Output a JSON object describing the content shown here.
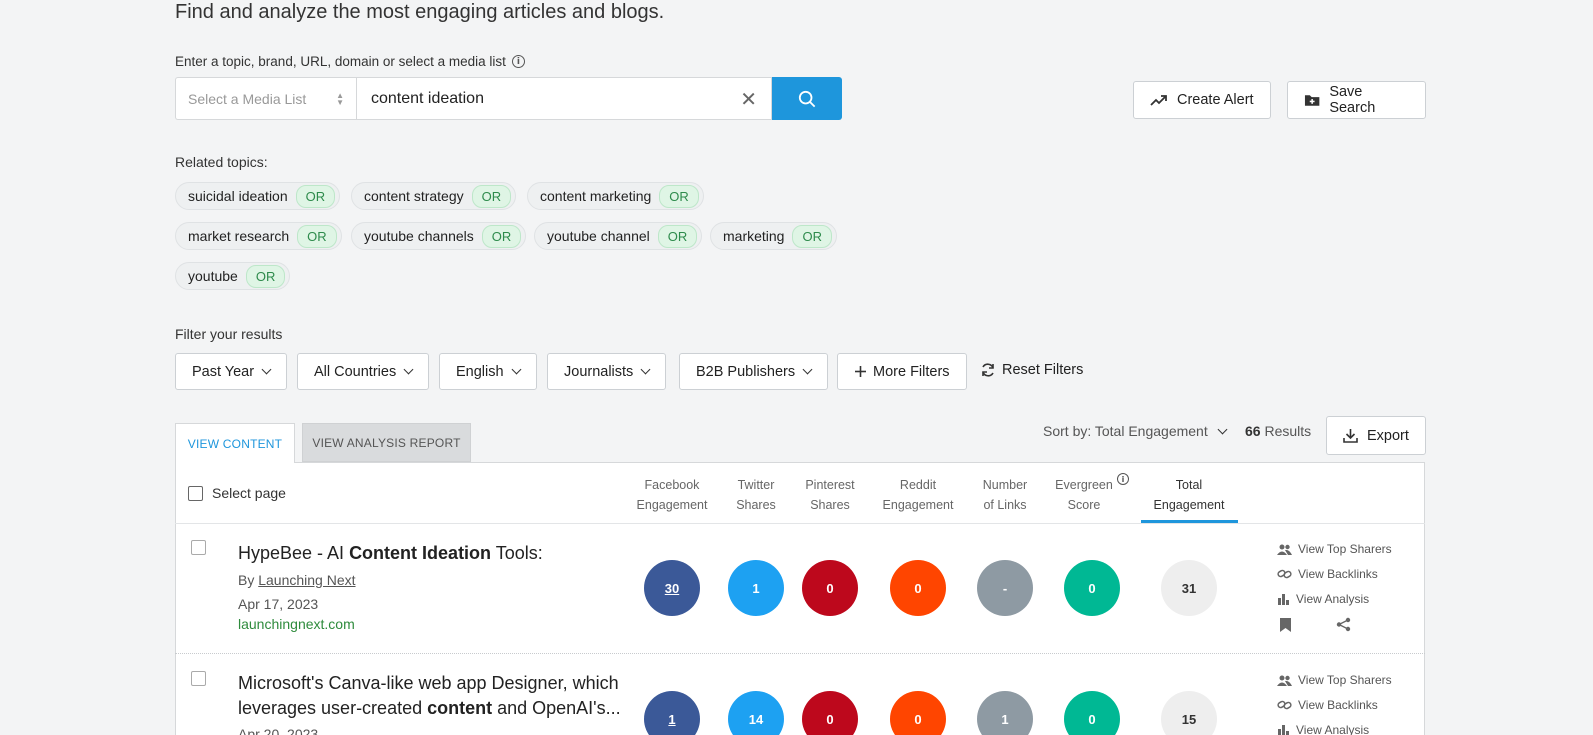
{
  "header": {
    "subtitle": "Find and analyze the most engaging articles and blogs."
  },
  "search": {
    "label": "Enter a topic, brand, URL, domain or select a media list",
    "media_list_placeholder": "Select a Media List",
    "query": "content ideation"
  },
  "actions": {
    "create_alert": "Create Alert",
    "save_search": "Save Search"
  },
  "related": {
    "label": "Related topics:",
    "or_label": "OR",
    "topics": [
      "suicidal ideation",
      "content strategy",
      "content marketing",
      "market research",
      "youtube channels",
      "youtube channel",
      "marketing",
      "youtube"
    ]
  },
  "filters": {
    "label": "Filter your results",
    "items": [
      "Past Year",
      "All Countries",
      "English",
      "Journalists",
      "B2B Publishers"
    ],
    "more": "More Filters",
    "reset": "Reset Filters"
  },
  "tabs": {
    "view_content": "VIEW CONTENT",
    "view_analysis": "VIEW ANALYSIS REPORT"
  },
  "sort": {
    "label": "Sort by: Total Engagement"
  },
  "results": {
    "count": "66",
    "label": "Results",
    "export": "Export"
  },
  "table": {
    "select_page": "Select page",
    "columns": [
      [
        "Facebook",
        "Engagement"
      ],
      [
        "Twitter",
        "Shares"
      ],
      [
        "Pinterest",
        "Shares"
      ],
      [
        "Reddit",
        "Engagement"
      ],
      [
        "Number",
        "of Links"
      ],
      [
        "Evergreen",
        "Score"
      ],
      [
        "Total",
        "Engagement"
      ]
    ]
  },
  "colors": {
    "facebook": "#3b5998",
    "twitter": "#1da1f2",
    "pinterest": "#bd081c",
    "reddit": "#ff4500",
    "links": "#8e9aa3",
    "evergreen": "#00b894",
    "total": "#eeeeee",
    "accent": "#1e96dc"
  },
  "row_actions": {
    "top_sharers": "View Top Sharers",
    "backlinks": "View Backlinks",
    "analysis": "View Analysis"
  },
  "articles": [
    {
      "title_pre": "HypeBee - AI ",
      "title_bold": "Content Ideation",
      "title_post": " Tools:",
      "by": "By",
      "author": "Launching Next",
      "date": "Apr 17, 2023",
      "domain": "launchingnext.com",
      "metrics": [
        "30",
        "1",
        "0",
        "0",
        "-",
        "0",
        "31"
      ]
    },
    {
      "title_line1": "Microsoft's Canva-like web app Designer, which",
      "title_line2_pre": "leverages user-created ",
      "title_line2_bold": "content",
      "title_line2_post": " and OpenAI's...",
      "date": "Apr 20, 2023",
      "metrics": [
        "1",
        "14",
        "0",
        "0",
        "1",
        "0",
        "15"
      ]
    }
  ]
}
